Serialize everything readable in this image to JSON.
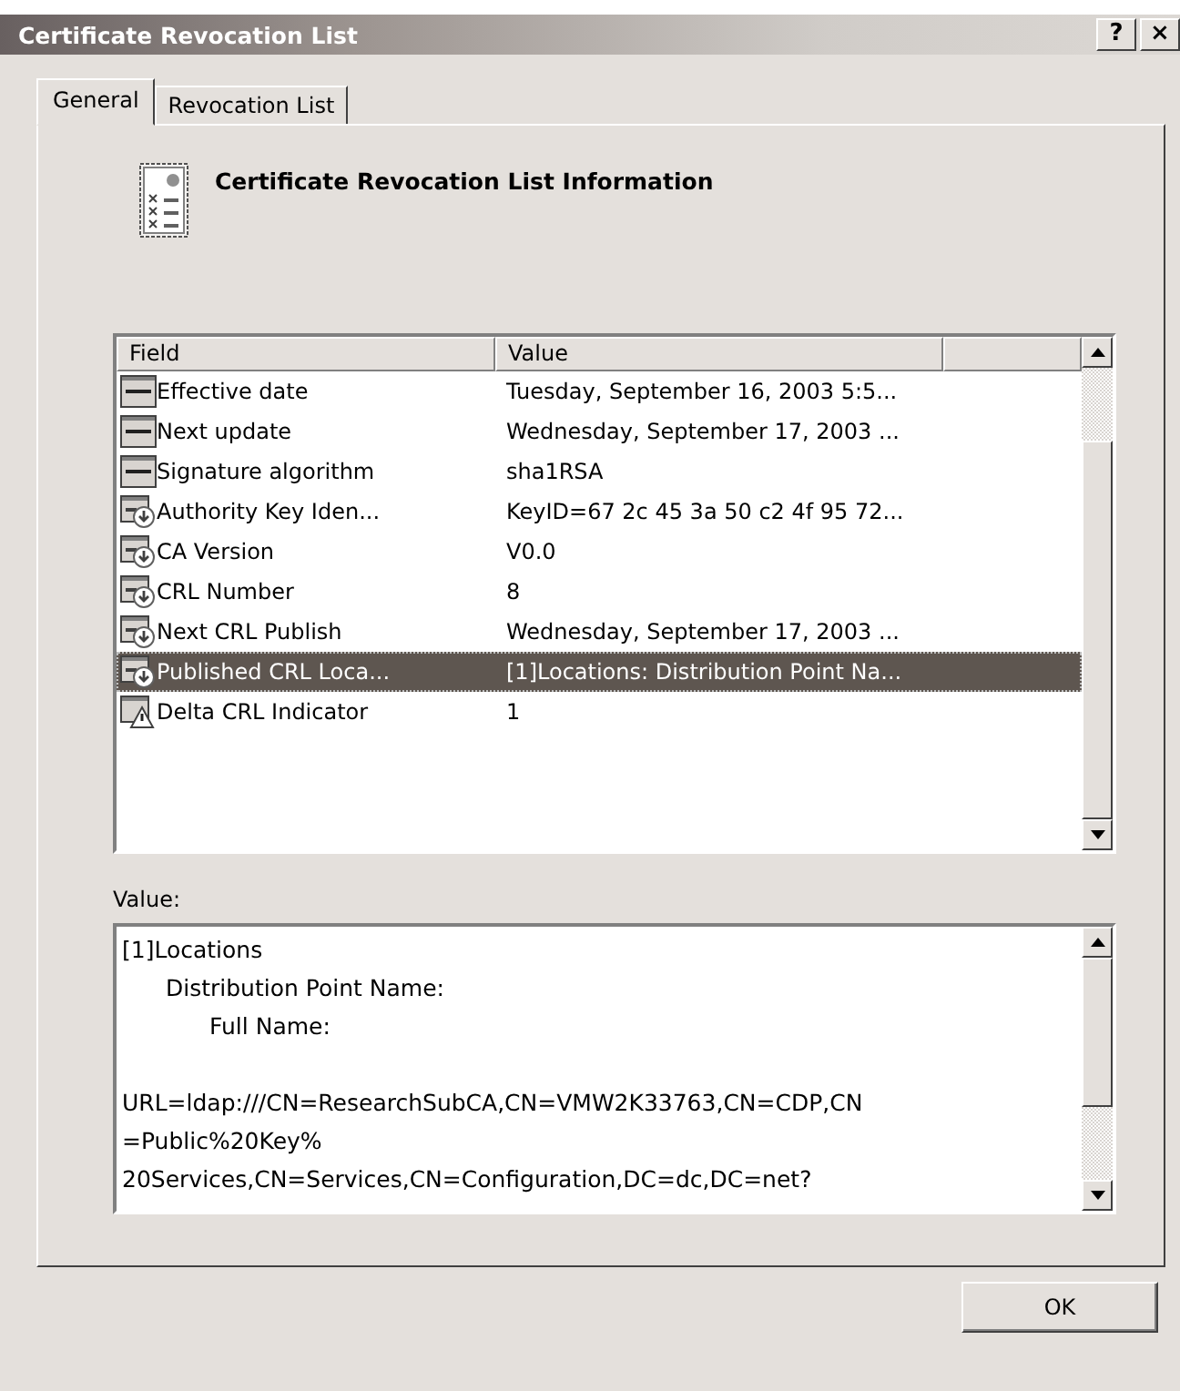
{
  "window": {
    "title": "Certificate Revocation List",
    "help_button": "?",
    "close_button": "×"
  },
  "tabs": [
    {
      "label": "General",
      "selected": true
    },
    {
      "label": "Revocation List",
      "selected": false
    }
  ],
  "heading": "Certificate Revocation List Information",
  "table": {
    "columns": [
      "Field",
      "Value"
    ],
    "rows": [
      {
        "kind": "basic",
        "field": "Effective date",
        "value": "Tuesday, September 16, 2003 5:5...",
        "selected": false
      },
      {
        "kind": "basic",
        "field": "Next update",
        "value": "Wednesday, September 17, 2003 ...",
        "selected": false
      },
      {
        "kind": "basic",
        "field": "Signature algorithm",
        "value": "sha1RSA",
        "selected": false
      },
      {
        "kind": "extension",
        "field": "Authority Key Iden...",
        "value": "KeyID=67 2c 45 3a 50 c2 4f 95 72...",
        "selected": false
      },
      {
        "kind": "extension",
        "field": "CA Version",
        "value": "V0.0",
        "selected": false
      },
      {
        "kind": "extension",
        "field": "CRL Number",
        "value": "8",
        "selected": false
      },
      {
        "kind": "extension",
        "field": "Next CRL Publish",
        "value": "Wednesday, September 17, 2003 ...",
        "selected": false
      },
      {
        "kind": "extension",
        "field": "Published CRL Loca...",
        "value": "[1]Locations: Distribution Point Na...",
        "selected": true
      },
      {
        "kind": "critical",
        "field": "Delta CRL Indicator",
        "value": "1",
        "selected": false
      }
    ]
  },
  "value_label": "Value:",
  "value_box": {
    "outline": [
      {
        "text": "[1]Locations",
        "children": [
          {
            "text": "Distribution Point Name:",
            "children": [
              {
                "text": "Full Name:"
              }
            ]
          }
        ]
      }
    ],
    "url_lines": [
      "URL=ldap:///CN=ResearchSubCA,CN=VMW2K33763,CN=CDP,CN",
      "=Public%20Key%",
      "20Services,CN=Services,CN=Configuration,DC=dc,DC=net?"
    ]
  },
  "buttons": [
    "OK"
  ]
}
